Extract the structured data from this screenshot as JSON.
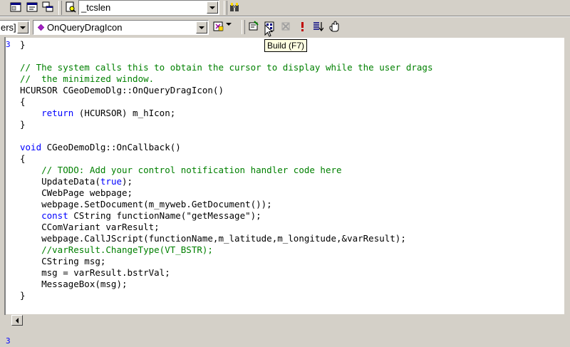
{
  "toolbar_top": {
    "combo_value": "_tcslen"
  },
  "toolbar_wizard": {
    "class_combo_value": "ers]",
    "member_combo_value": "OnQueryDragIcon"
  },
  "tooltip": {
    "text": "Build (F7)"
  },
  "editor": {
    "gutter_marks": [
      "3",
      "",
      "",
      "",
      "",
      "",
      "",
      "",
      "",
      "",
      "",
      "",
      "",
      "",
      "",
      "",
      "",
      "",
      "",
      "",
      "",
      "",
      "",
      "",
      "",
      "",
      "3"
    ],
    "lines": [
      {
        "text": "}",
        "kind": "plain"
      },
      {
        "text": "",
        "kind": "plain"
      },
      {
        "text": "// The system calls this to obtain the cursor to display while the user drags",
        "kind": "comment"
      },
      {
        "text": "//  the minimized window.",
        "kind": "comment"
      },
      {
        "text": "HCURSOR CGeoDemoDlg::OnQueryDragIcon()",
        "kind": "plain"
      },
      {
        "text": "{",
        "kind": "plain"
      },
      {
        "pre": "    ",
        "kw": "return",
        "post": " (HCURSOR) m_hIcon;",
        "kind": "mixed"
      },
      {
        "text": "}",
        "kind": "plain"
      },
      {
        "text": "",
        "kind": "plain"
      },
      {
        "pre": "",
        "kw": "void",
        "post": " CGeoDemoDlg::OnCallback()",
        "kind": "mixed"
      },
      {
        "text": "{",
        "kind": "plain"
      },
      {
        "text": "    // TODO: Add your control notification handler code here",
        "kind": "comment"
      },
      {
        "pre": "    UpdateData(",
        "kw": "true",
        "post": ");",
        "kind": "mixed"
      },
      {
        "text": "    CWebPage webpage;",
        "kind": "plain"
      },
      {
        "text": "    webpage.SetDocument(m_myweb.GetDocument());",
        "kind": "plain"
      },
      {
        "pre": "    ",
        "kw": "const",
        "post": " CString functionName(\"getMessage\");",
        "kind": "mixed"
      },
      {
        "text": "    CComVariant varResult;",
        "kind": "plain"
      },
      {
        "text": "    webpage.CallJScript(functionName,m_latitude,m_longitude,&varResult);",
        "kind": "plain"
      },
      {
        "text": "    //varResult.ChangeType(VT_BSTR);",
        "kind": "comment"
      },
      {
        "text": "    CString msg;",
        "kind": "plain"
      },
      {
        "text": "    msg = varResult.bstrVal;",
        "kind": "plain"
      },
      {
        "text": "    MessageBox(msg);",
        "kind": "plain"
      },
      {
        "text": "}",
        "kind": "plain"
      }
    ]
  }
}
